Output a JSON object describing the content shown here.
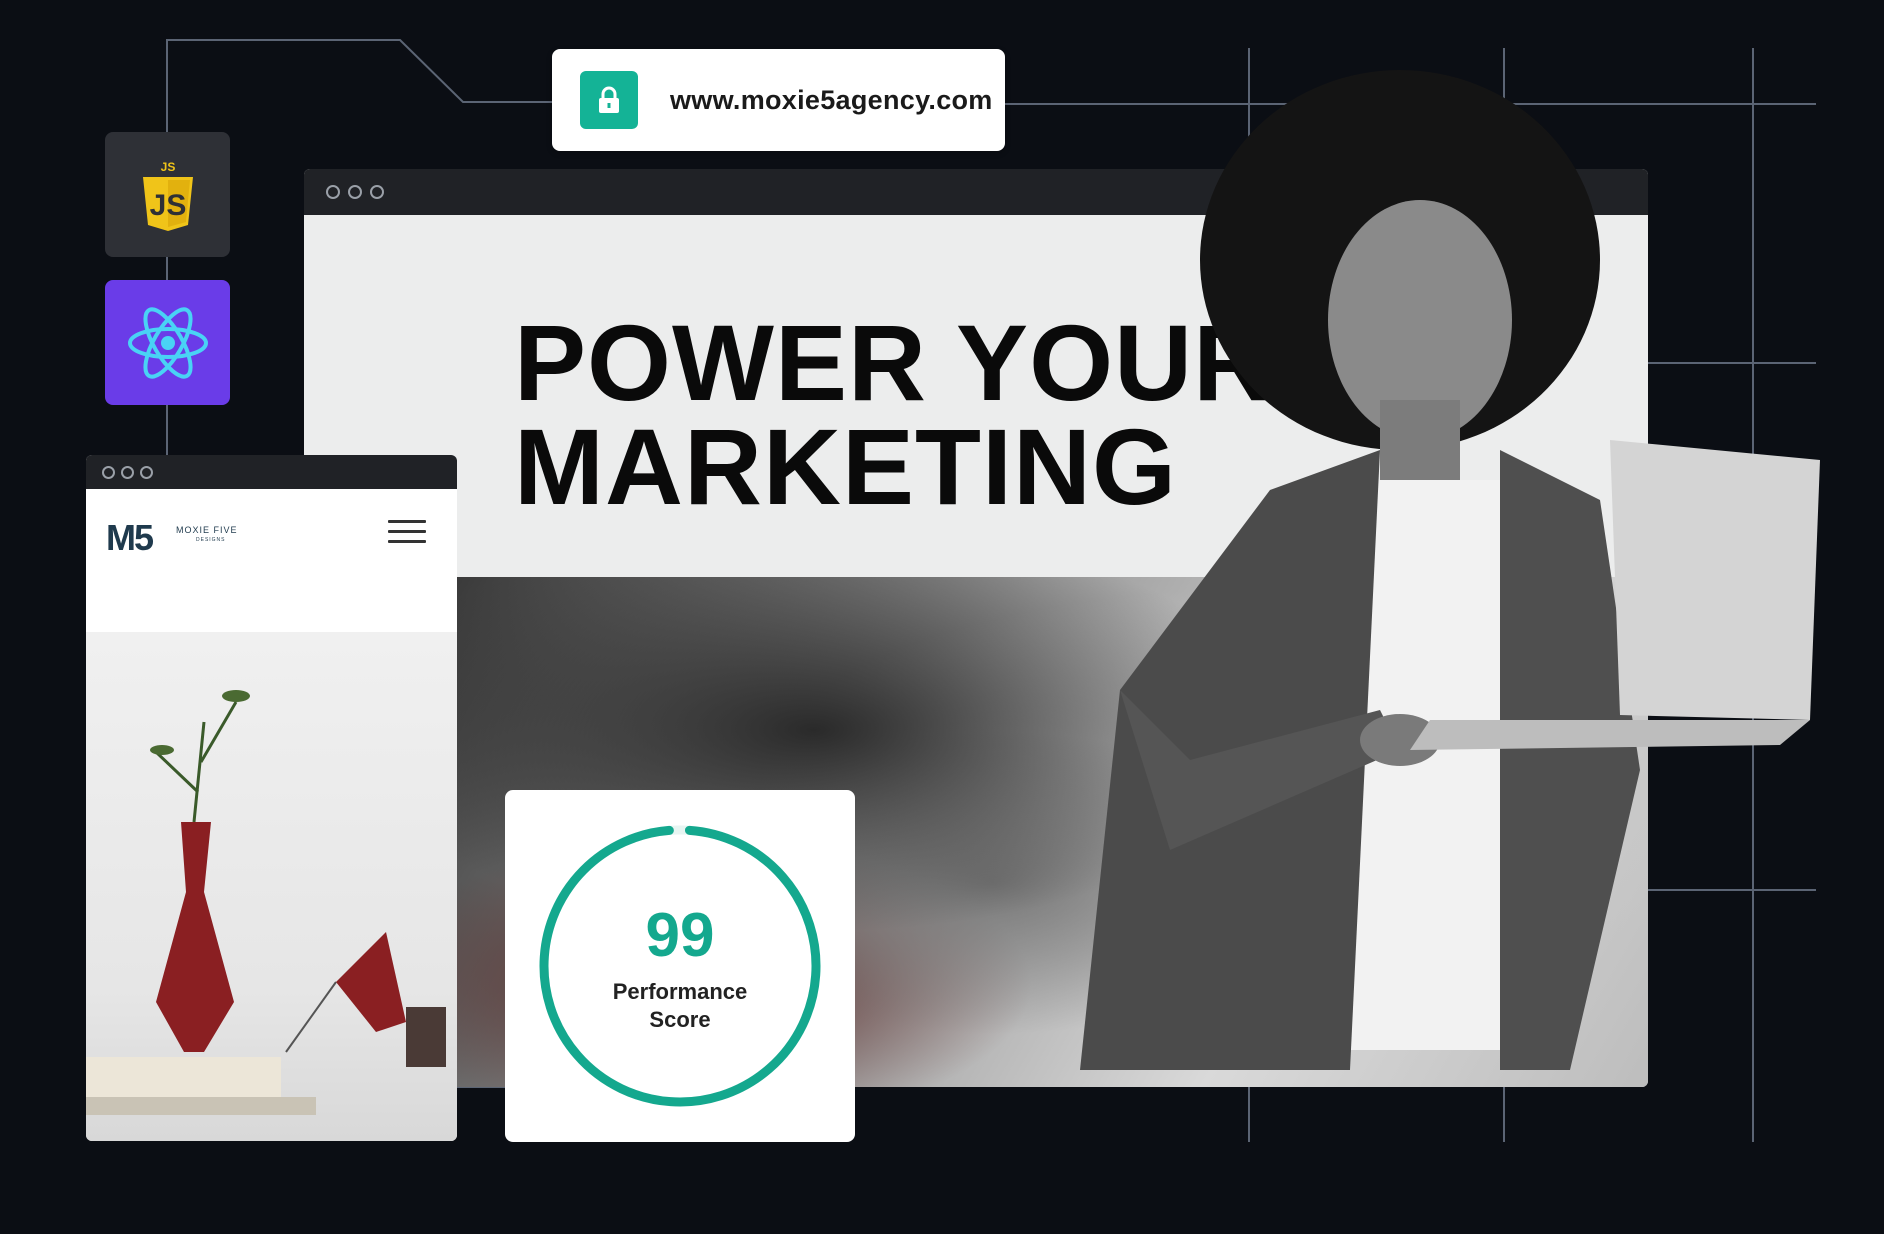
{
  "url_bar": {
    "url": "www.moxie5agency.com",
    "icon": "lock-icon",
    "accent_color": "#14b396"
  },
  "badges": [
    {
      "name": "javascript",
      "text": "JS",
      "color": "#f0c419"
    },
    {
      "name": "react",
      "icon": "react-icon",
      "color": "#6a3ce8"
    }
  ],
  "desktop": {
    "hero_line1": "POWER YOUR",
    "hero_line2": "MARKETING"
  },
  "mobile": {
    "logo": "M5",
    "brand": "MOXIE FIVE",
    "brand_sub": "DESIGNS",
    "menu_icon": "hamburger-icon"
  },
  "score": {
    "value": "99",
    "label_line1": "Performance",
    "label_line2": "Score",
    "fraction": 0.99,
    "color": "#14a88e"
  }
}
